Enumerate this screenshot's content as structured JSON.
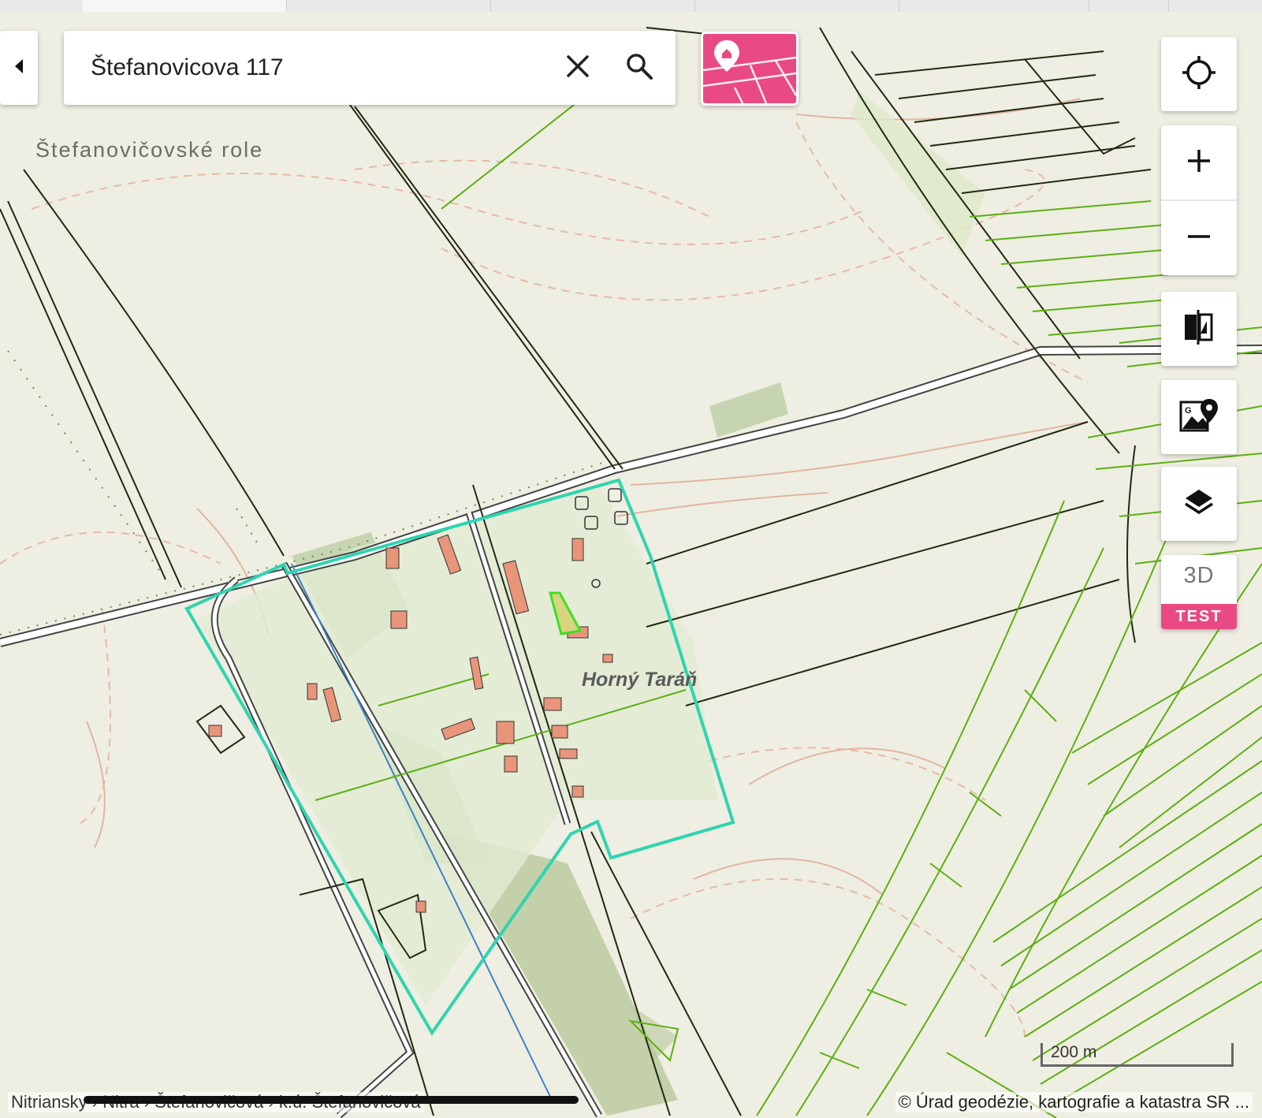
{
  "search": {
    "value": "Štefanovicova 117",
    "clear_icon": "close-icon",
    "search_icon": "search-icon"
  },
  "map": {
    "place_label": "Štefanovičovské role",
    "village_label": "Horný Taráň",
    "scale_label": "200 m",
    "breadcrumb": "Nitriansky › Nitra › Štefanovičová › k.ú. Štefanovičová",
    "attribution": "© Úrad geodézie, kartografie a katastra SR ..."
  },
  "controls": {
    "locate_icon": "crosshair-icon",
    "zoom_in_icon": "plus-icon",
    "zoom_out_icon": "minus-icon",
    "compare_icon": "split-compare-icon",
    "geo_icon": "map-pin-image-icon",
    "layers_icon": "layers-icon",
    "threed_label": "3D",
    "threed_badge": "TEST"
  },
  "colors": {
    "accent": "#e94a84",
    "parcel_line": "#5bb012",
    "selection_outline": "#2fd4b0",
    "building": "#e8957a",
    "map_background": "#efeee2"
  }
}
